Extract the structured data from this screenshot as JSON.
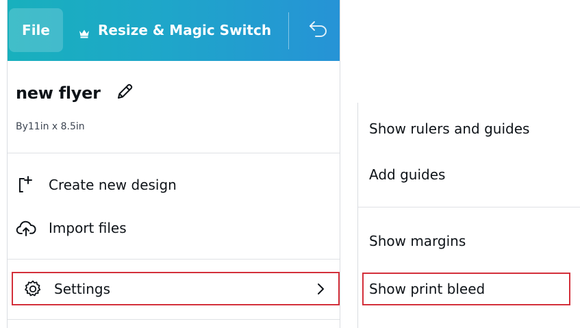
{
  "topbar": {
    "file_label": "File",
    "resize_label": "Resize & Magic Switch",
    "crown_icon": "crown-icon",
    "undo_icon": "undo-icon",
    "gradient_start": "#18b0bd",
    "gradient_end": "#2693d6"
  },
  "design": {
    "title": "new flyer",
    "size": "By11in x 8.5in"
  },
  "menu": {
    "items": [
      {
        "label": "Create new design",
        "icon": "create-design-icon"
      },
      {
        "label": "Import files",
        "icon": "cloud-upload-icon"
      }
    ],
    "settings_label": "Settings"
  },
  "settings_submenu": {
    "items": [
      {
        "label": "Show rulers and guides"
      },
      {
        "label": "Add guides"
      },
      {
        "label": "Show margins"
      },
      {
        "label": "Show print bleed"
      }
    ]
  },
  "colors": {
    "highlight_border": "#d32f3a",
    "divider": "#dfe1e5"
  }
}
